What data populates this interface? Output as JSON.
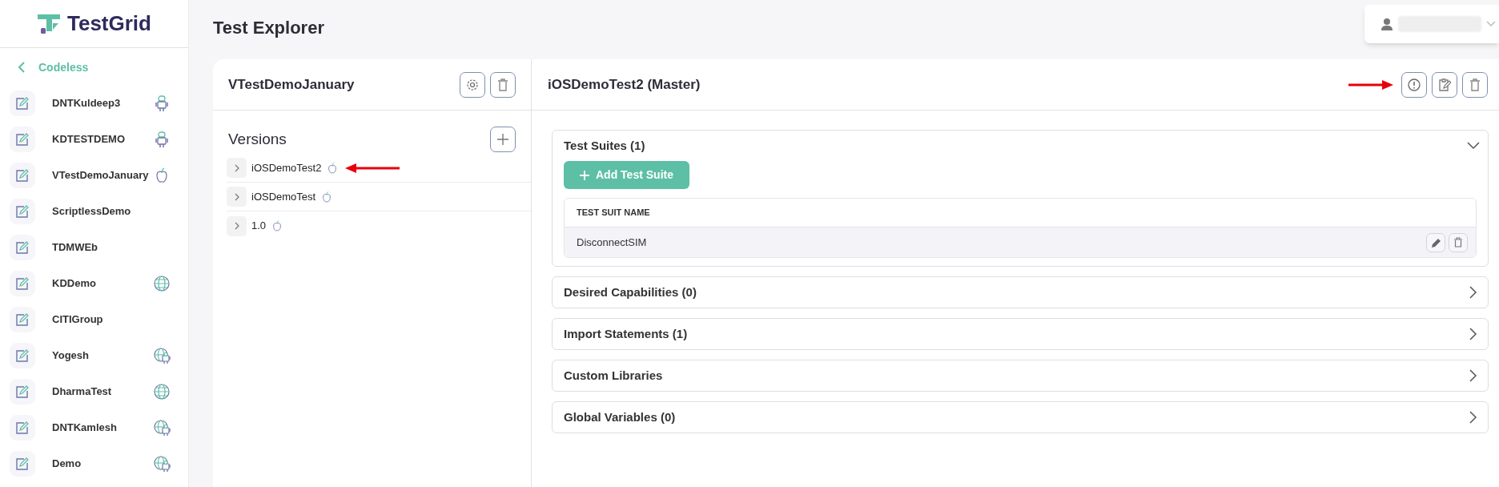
{
  "brand": {
    "name": "TestGrid"
  },
  "sidebar": {
    "back_label": "Codeless",
    "items": [
      {
        "label": "DNTKuldeep3",
        "kind": "android"
      },
      {
        "label": "KDTESTDEMO",
        "kind": "android"
      },
      {
        "label": "VTestDemoJanuary",
        "kind": "ios"
      },
      {
        "label": "ScriptlessDemo",
        "kind": "none"
      },
      {
        "label": "TDMWEb",
        "kind": "none"
      },
      {
        "label": "KDDemo",
        "kind": "web"
      },
      {
        "label": "CITIGroup",
        "kind": "none"
      },
      {
        "label": "Yogesh",
        "kind": "hybrid"
      },
      {
        "label": "DharmaTest",
        "kind": "web"
      },
      {
        "label": "DNTKamlesh",
        "kind": "hybrid"
      },
      {
        "label": "Demo",
        "kind": "hybrid"
      }
    ]
  },
  "page_title": "Test Explorer",
  "project": {
    "title": "VTestDemoJanuary",
    "versions_heading": "Versions",
    "versions": [
      {
        "label": "iOSDemoTest2",
        "expanded": false,
        "kind": "ios"
      },
      {
        "label": "iOSDemoTest",
        "expanded": false,
        "kind": "ios"
      },
      {
        "label": "1.0",
        "expanded": false,
        "kind": "ios"
      }
    ]
  },
  "detail": {
    "title": "iOSDemoTest2 (Master)",
    "sections": [
      {
        "title": "Test Suites (1)",
        "expanded": true,
        "add_button": "Add Test Suite",
        "table": {
          "columns": [
            "TEST SUIT NAME"
          ],
          "rows": [
            [
              "DisconnectSIM"
            ]
          ]
        }
      },
      {
        "title": "Desired Capabilities (0)",
        "expanded": false
      },
      {
        "title": "Import Statements (1)",
        "expanded": false
      },
      {
        "title": "Custom Libraries",
        "expanded": false
      },
      {
        "title": "Global Variables (0)",
        "expanded": false
      }
    ]
  }
}
